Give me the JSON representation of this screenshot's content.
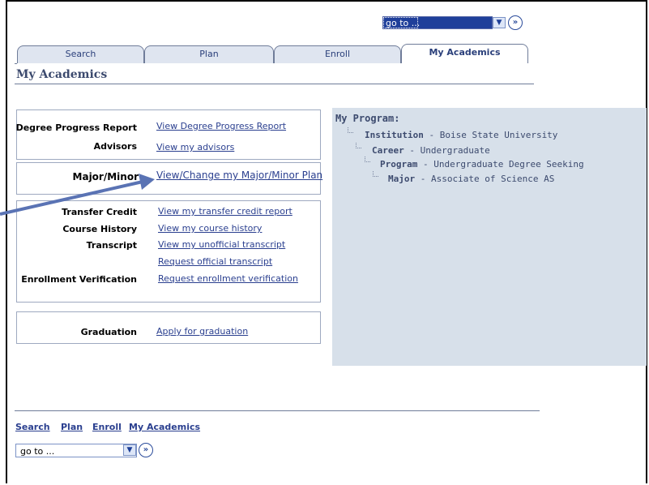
{
  "goto": {
    "value": "go to ..."
  },
  "tabs": [
    {
      "label": "Search"
    },
    {
      "label": "Plan"
    },
    {
      "label": "Enroll"
    },
    {
      "label": "My Academics"
    }
  ],
  "page_title": "My Academics",
  "groups": {
    "g1": [
      {
        "label": "Degree Progress Report",
        "link": "View Degree Progress Report"
      },
      {
        "label": "Advisors",
        "link": "View my advisors"
      }
    ],
    "g2": [
      {
        "label": "Major/Minor",
        "link": "View/Change my Major/Minor Plan"
      }
    ],
    "g3": [
      {
        "label": "Transfer Credit",
        "link": "View my transfer credit report"
      },
      {
        "label": "Course History",
        "link": "View my course history"
      },
      {
        "label": "Transcript",
        "link": "View my unofficial transcript"
      },
      {
        "label": "",
        "link": "Request official transcript"
      },
      {
        "label": "Enrollment Verification",
        "link": "Request enrollment verification"
      }
    ],
    "g4": [
      {
        "label": "Graduation",
        "link": "Apply for graduation"
      }
    ]
  },
  "program": {
    "title": "My Program:",
    "rows": [
      {
        "key": "Institution",
        "value": "Boise State University"
      },
      {
        "key": "Career",
        "value": "Undergraduate"
      },
      {
        "key": "Program",
        "value": "Undergraduate Degree Seeking"
      },
      {
        "key": "Major",
        "value": "Associate of Science AS"
      }
    ]
  },
  "bottom_nav": [
    {
      "label": "Search"
    },
    {
      "label": "Plan"
    },
    {
      "label": "Enroll"
    },
    {
      "label": "My Academics"
    }
  ],
  "colors": {
    "accent": "#2a3f8f",
    "program_bg": "#d7e0ea",
    "annotation_arrow": "#5a73b4"
  }
}
